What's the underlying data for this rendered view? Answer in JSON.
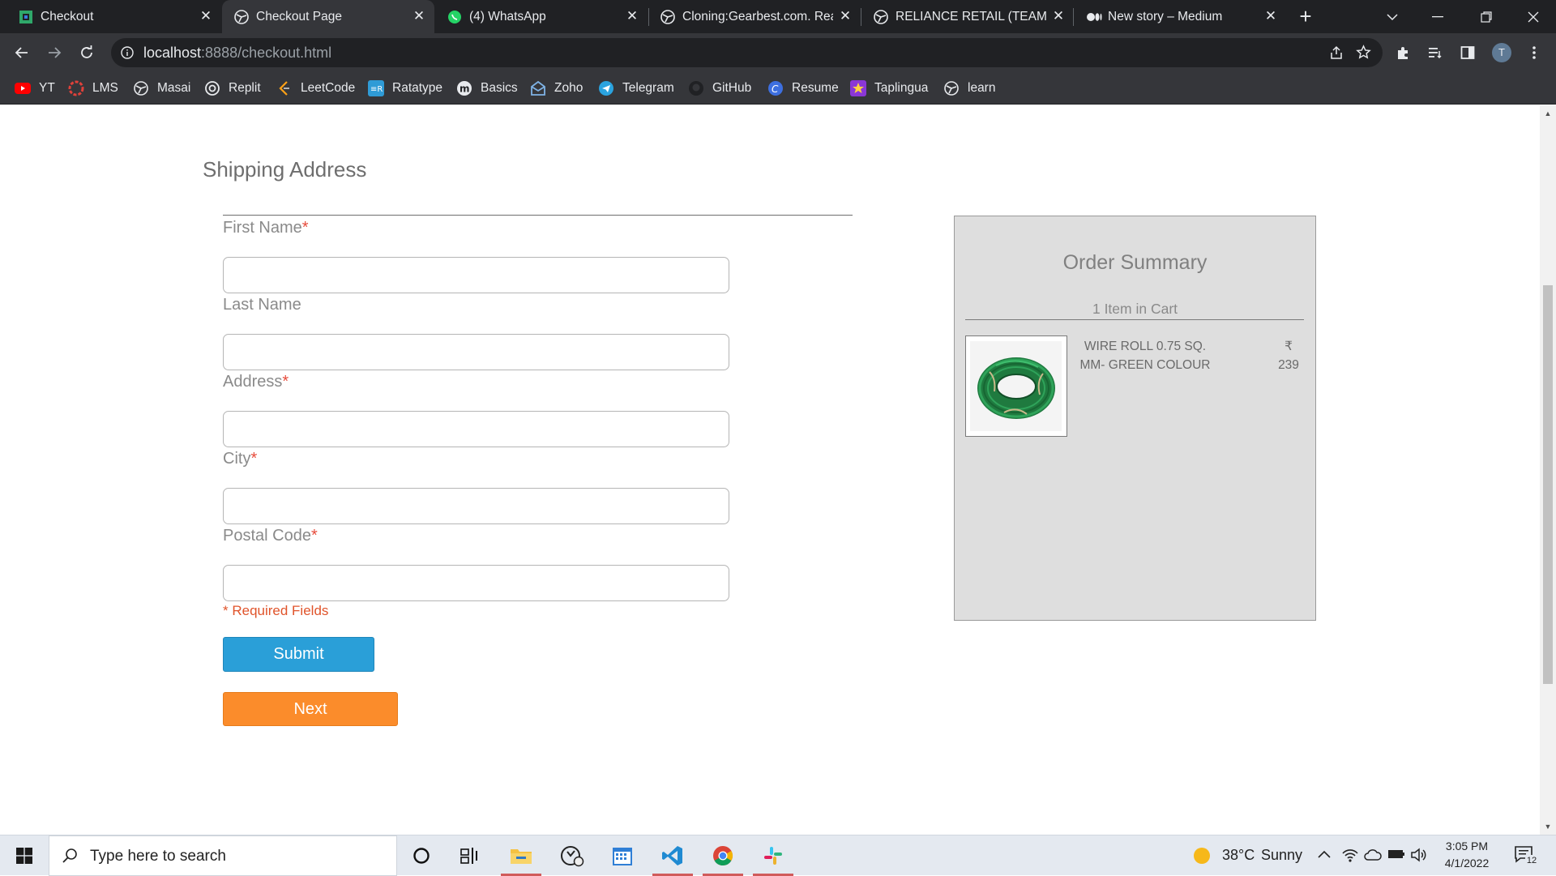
{
  "browser": {
    "tabs": [
      {
        "title": "Checkout",
        "active": false
      },
      {
        "title": "Checkout Page",
        "active": true
      },
      {
        "title": "(4) WhatsApp",
        "active": false
      },
      {
        "title": "Cloning:Gearbest.com. React",
        "active": false
      },
      {
        "title": "RELIANCE RETAIL (TEAM — ",
        "active": false
      },
      {
        "title": "New story – Medium",
        "active": false
      }
    ],
    "url_host": "localhost",
    "url_path": ":8888/checkout.html",
    "profile_initial": "T",
    "bookmarks": [
      {
        "label": "YT",
        "icon": "youtube-icon"
      },
      {
        "label": "LMS",
        "icon": "lms-icon"
      },
      {
        "label": "Masai",
        "icon": "globe-icon"
      },
      {
        "label": "Replit",
        "icon": "replit-icon"
      },
      {
        "label": "LeetCode",
        "icon": "leetcode-icon"
      },
      {
        "label": "Ratatype",
        "icon": "ratatype-icon"
      },
      {
        "label": "Basics",
        "icon": "basics-icon"
      },
      {
        "label": "Zoho",
        "icon": "zoho-icon"
      },
      {
        "label": "Telegram",
        "icon": "telegram-icon"
      },
      {
        "label": "GitHub",
        "icon": "github-icon"
      },
      {
        "label": "Resume",
        "icon": "resume-icon"
      },
      {
        "label": "Taplingua",
        "icon": "taplingua-icon"
      },
      {
        "label": "learn",
        "icon": "globe-icon"
      }
    ]
  },
  "shipping": {
    "title": "Shipping Address",
    "fields": [
      {
        "label": "First Name",
        "required": true,
        "value": "",
        "placeholder": ""
      },
      {
        "label": "Last Name",
        "required": false,
        "value": "",
        "placeholder": ""
      },
      {
        "label": "Address",
        "required": true,
        "value": "",
        "placeholder": ""
      },
      {
        "label": "City",
        "required": true,
        "value": "",
        "placeholder": ""
      },
      {
        "label": "Postal Code",
        "required": true,
        "value": "",
        "placeholder": ""
      }
    ],
    "required_marker": "*",
    "required_note": "* Required Fields",
    "submit_label": "Submit",
    "next_label": "Next"
  },
  "order_summary": {
    "title": "Order Summary",
    "item_count": "1 Item in Cart",
    "items": [
      {
        "name": "WIRE ROLL 0.75 SQ. MM- GREEN COLOUR",
        "currency": "₹",
        "price": "239",
        "image": "green-wire-roll"
      }
    ]
  },
  "taskbar": {
    "search_placeholder": "Type here to search",
    "weather_temp": "38°C",
    "weather_desc": "Sunny",
    "time": "3:05 PM",
    "date": "4/1/2022",
    "notification_count": "12",
    "apps": [
      "cortana-icon",
      "task-view-icon",
      "file-explorer-icon",
      "yoshi-icon",
      "calendar-icon",
      "vscode-icon",
      "chrome-icon",
      "slack-icon"
    ]
  },
  "colors": {
    "submit": "#2a9fd8",
    "next": "#fb8c2b",
    "required": "#e74c3c",
    "summary_bg": "#dedede"
  }
}
